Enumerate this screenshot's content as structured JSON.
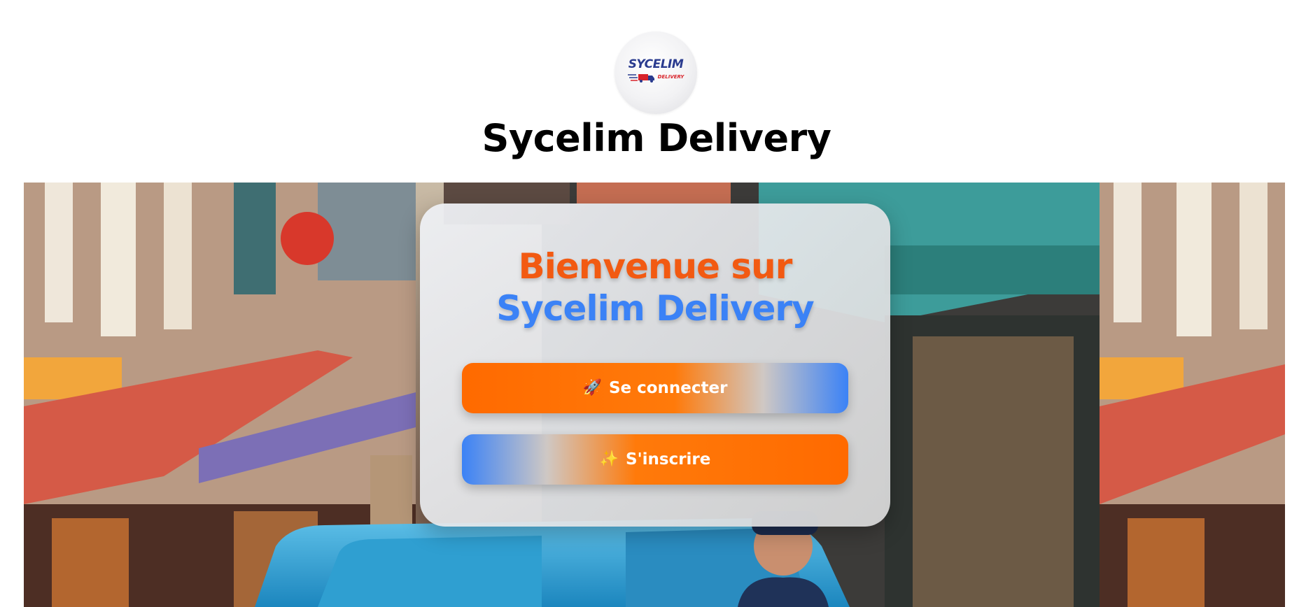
{
  "header": {
    "logo_text": "SYCELIM",
    "logo_sub": "DELIVERY",
    "title": "Sycelim Delivery"
  },
  "card": {
    "welcome_line1": "Bienvenue sur",
    "welcome_line2": "Sycelim Delivery",
    "login_icon": "🚀",
    "login_label": "Se connecter",
    "signup_icon": "✨",
    "signup_label": "S'inscrire"
  },
  "colors": {
    "accent_orange": "#f25a12",
    "accent_blue": "#3b82f6"
  },
  "icons": {
    "login": "rocket-icon",
    "signup": "sparkles-icon",
    "logo": "delivery-truck-icon"
  }
}
